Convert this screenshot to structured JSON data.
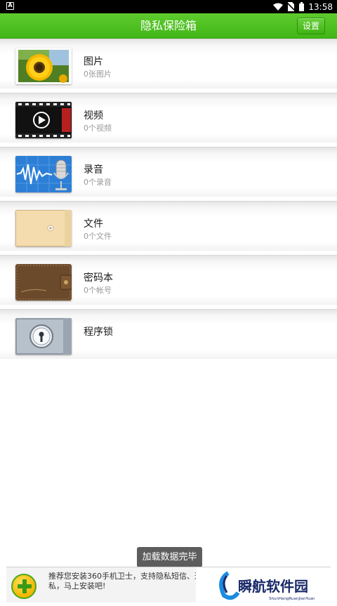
{
  "status_bar": {
    "time": "13:58",
    "left_icon": "A"
  },
  "header": {
    "title": "隐私保险箱",
    "settings_label": "设置"
  },
  "items": [
    {
      "title": "图片",
      "subtitle": "0张图片",
      "icon": "sunflower-photo-icon"
    },
    {
      "title": "视频",
      "subtitle": "0个视频",
      "icon": "video-film-icon"
    },
    {
      "title": "录音",
      "subtitle": "0个录音",
      "icon": "microphone-icon"
    },
    {
      "title": "文件",
      "subtitle": "0个文件",
      "icon": "envelope-folder-icon"
    },
    {
      "title": "密码本",
      "subtitle": "0个帐号",
      "icon": "password-wallet-icon"
    },
    {
      "title": "程序锁",
      "subtitle": "",
      "icon": "lock-icon"
    }
  ],
  "toast": "加载数据完毕",
  "ad": {
    "text": "推荐您安装360手机卫士，支持隐私短信、通话的隐私，马上安装吧!",
    "watermark_text": "瞬航软件园",
    "watermark_sub": "ShunHangRuanJianYuan"
  },
  "colors": {
    "header_green": "#41b616",
    "toast_bg": "#5d5d5d"
  }
}
